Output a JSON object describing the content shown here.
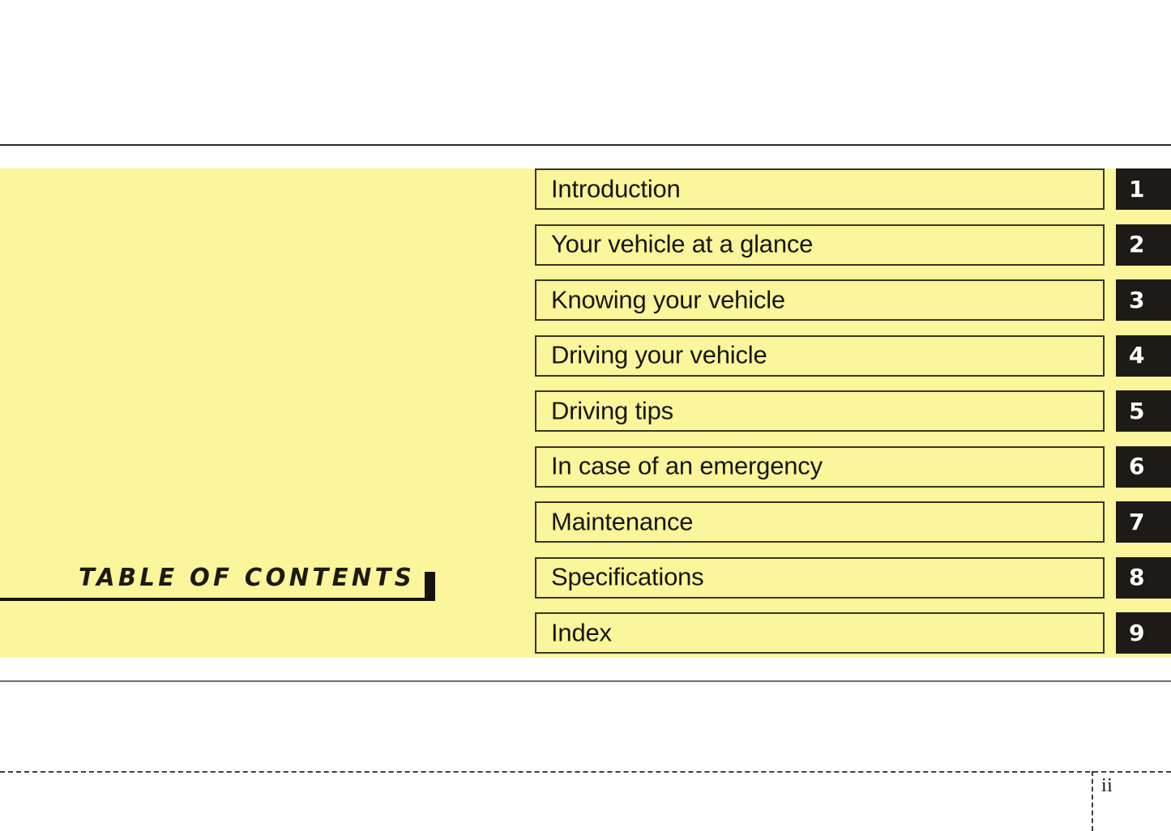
{
  "page": {
    "title": "TABLE OF CONTENTS",
    "page_number": "ii",
    "accent_yellow": "#FBF59B",
    "tab_black": "#1d1a17",
    "text_black": "#181712"
  },
  "toc": {
    "entries": [
      {
        "label": "Introduction",
        "number": "1"
      },
      {
        "label": "Your vehicle at a glance",
        "number": "2"
      },
      {
        "label": "Knowing your vehicle",
        "number": "3"
      },
      {
        "label": "Driving your vehicle",
        "number": "4"
      },
      {
        "label": "Driving tips",
        "number": "5"
      },
      {
        "label": "In case of an emergency",
        "number": "6"
      },
      {
        "label": "Maintenance",
        "number": "7"
      },
      {
        "label": "Specifications",
        "number": "8"
      },
      {
        "label": "Index",
        "number": "9"
      }
    ]
  }
}
